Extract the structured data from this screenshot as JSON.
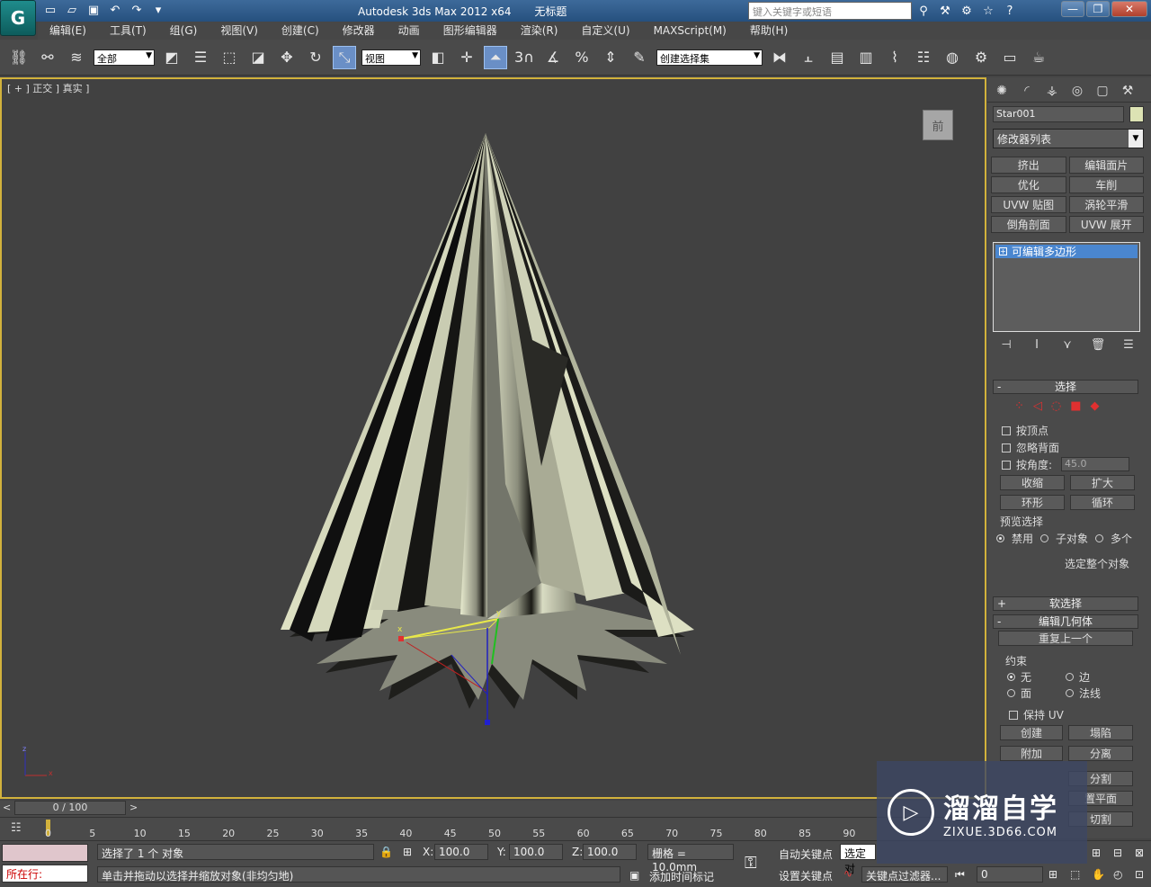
{
  "titlebar": {
    "app_title": "Autodesk 3ds Max  2012 x64",
    "doc_title": "无标题",
    "search_placeholder": "键入关键字或短语",
    "app_logo": "G"
  },
  "menu": [
    "编辑(E)",
    "工具(T)",
    "组(G)",
    "视图(V)",
    "创建(C)",
    "修改器",
    "动画",
    "图形编辑器",
    "渲染(R)",
    "自定义(U)",
    "MAXScript(M)",
    "帮助(H)"
  ],
  "toolbar": {
    "selection_filter": "全部",
    "ref_coord": "视图",
    "named_selection": "创建选择集",
    "snap_3": "3",
    "percent": "%"
  },
  "viewport": {
    "label": "[ + ] 正交 ] 真实 ]",
    "viewcube_label": "前",
    "gizmo_x": "x",
    "gizmo_y": "y",
    "tripod_x": "x",
    "tripod_z": "z"
  },
  "command_panel": {
    "object_name": "Star001",
    "object_color": "#dde3b4",
    "modifier_list": "修改器列表",
    "modifier_buttons": [
      "挤出",
      "编辑面片",
      "优化",
      "车削",
      "UVW 贴图",
      "涡轮平滑",
      "倒角剖面",
      "UVW 展开"
    ],
    "stack_item": "可编辑多边形",
    "selection": {
      "title": "选择",
      "by_vertex": "按顶点",
      "ignore_backfacing": "忽略背面",
      "by_angle": "按角度:",
      "angle_value": "45.0",
      "shrink": "收缩",
      "grow": "扩大",
      "ring": "环形",
      "loop": "循环",
      "preview_title": "预览选择",
      "preview_disabled": "禁用",
      "preview_subobject": "子对象",
      "preview_multi": "多个",
      "whole_object": "选定整个对象"
    },
    "soft_selection": "软选择",
    "edit_geometry": {
      "title": "编辑几何体",
      "repeat_last": "重复上一个",
      "constraints": "约束",
      "none": "无",
      "edge": "边",
      "face": "面",
      "normal": "法线",
      "preserve_uv": "保持 UV",
      "create": "创建",
      "collapse": "塌陷",
      "attach": "附加",
      "detach": "分离",
      "slice_plane": "分割",
      "slice_plane_2": "置平面",
      "cut": "切割"
    }
  },
  "timeline": {
    "frame_display": "0 / 100",
    "ticks": [
      "0",
      "5",
      "10",
      "15",
      "20",
      "25",
      "30",
      "35",
      "40",
      "45",
      "50",
      "55",
      "60",
      "65",
      "70",
      "75",
      "80",
      "85",
      "90"
    ]
  },
  "status": {
    "selected_text": "选择了 1 个 对象",
    "prompt": "单击并拖动以选择并缩放对象(非均匀地)",
    "running": "所在行:",
    "x_label": "X:",
    "x_value": "100.0",
    "y_label": "Y:",
    "y_value": "100.0",
    "z_label": "Z:",
    "z_value": "100.0",
    "grid": "栅格 = 10.0mm",
    "add_time_tag": "添加时间标记",
    "auto_key": "自动关键点",
    "set_key": "设置关键点",
    "selected": "选定对",
    "key_filters": "关键点过滤器...",
    "frame": "0"
  },
  "watermark": {
    "brand": "溜溜自学",
    "url": "ZIXUE.3D66.COM"
  }
}
